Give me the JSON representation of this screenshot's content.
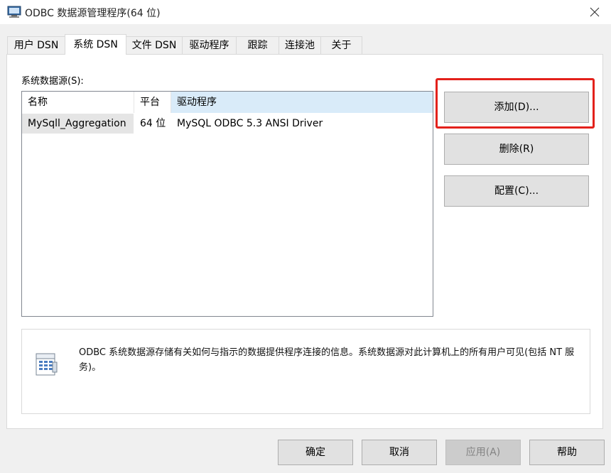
{
  "window": {
    "title": "ODBC 数据源管理程序(64 位)",
    "close_icon": "close-icon",
    "app_icon": "odbc-app-icon"
  },
  "tabs": [
    {
      "label": "用户 DSN",
      "selected": false
    },
    {
      "label": "系统 DSN",
      "selected": true
    },
    {
      "label": "文件 DSN",
      "selected": false
    },
    {
      "label": "驱动程序",
      "selected": false
    },
    {
      "label": "跟踪",
      "selected": false
    },
    {
      "label": "连接池",
      "selected": false
    },
    {
      "label": "关于",
      "selected": false
    }
  ],
  "system_dsn": {
    "section_label": "系统数据源(S):",
    "columns": [
      "名称",
      "平台",
      "驱动程序"
    ],
    "rows": [
      {
        "name": "MySqll_Aggregation",
        "platform": "64 位",
        "driver": "MySQL ODBC 5.3 ANSI Driver"
      }
    ],
    "buttons": {
      "add": "添加(D)...",
      "remove": "删除(R)",
      "configure": "配置(C)..."
    },
    "info_text": "ODBC 系统数据源存储有关如何与指示的数据提供程序连接的信息。系统数据源对此计算机上的所有用户可见(包括 NT 服务)。",
    "info_icon": "datasource-info-icon"
  },
  "footer": {
    "ok": "确定",
    "cancel": "取消",
    "apply": "应用(A)",
    "help": "帮助"
  },
  "colors": {
    "highlight_annotation": "#e3211b",
    "header_selected_bg": "#d9ebf9",
    "row_name_bg": "#e5e5e5"
  }
}
